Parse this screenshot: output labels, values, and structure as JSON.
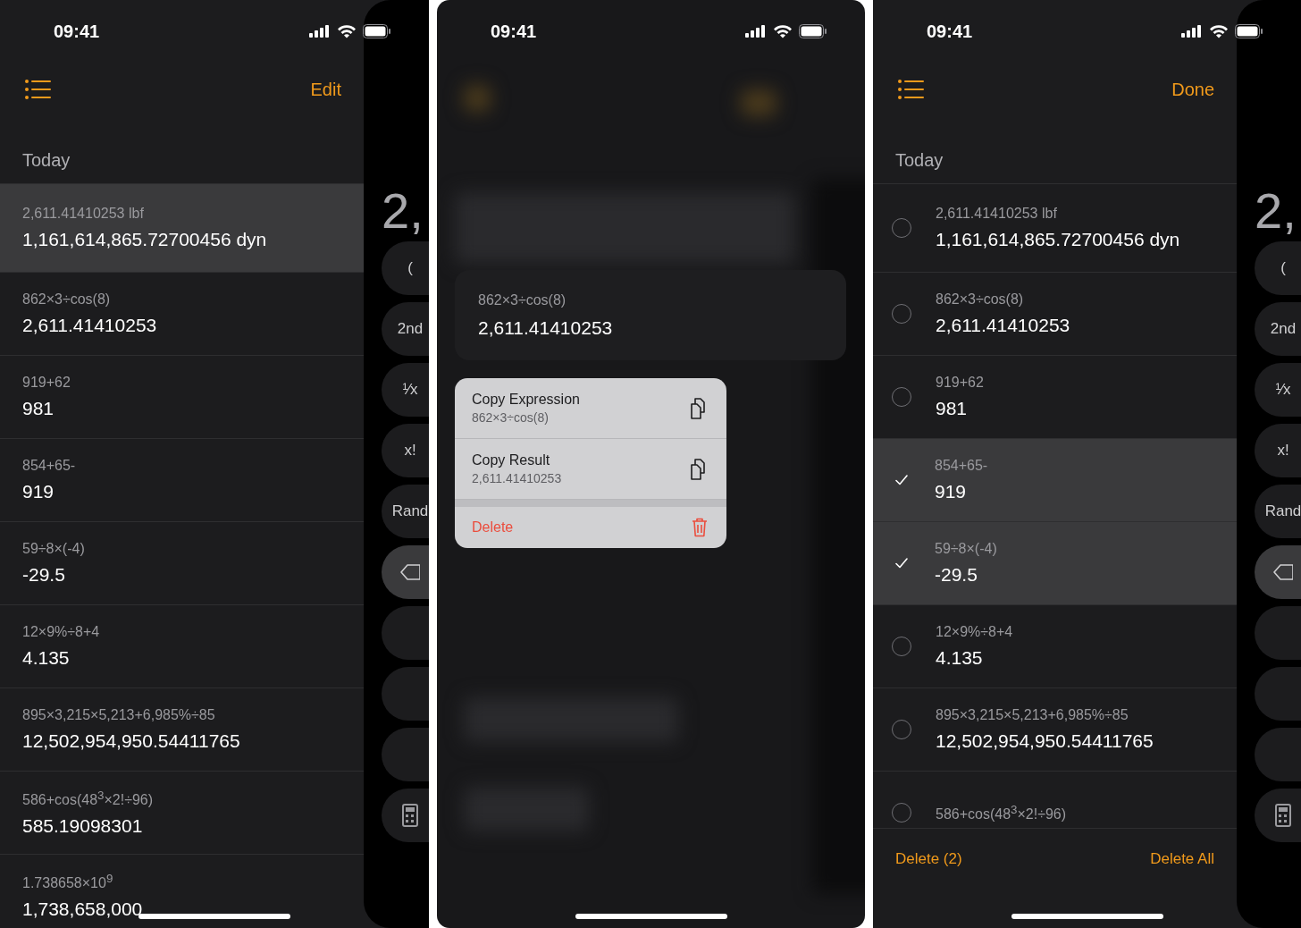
{
  "screens": [
    {
      "kind": "history",
      "time": "09:41",
      "nav_action": "Edit",
      "section": "Today",
      "items": [
        {
          "expression": "2,611.41410253 lbf",
          "result": "1,161,614,865.72700456 dyn",
          "selected": true
        },
        {
          "expression": "862×3÷cos(8)",
          "result": "2,611.41410253",
          "selected": false
        },
        {
          "expression": "919+62",
          "result": "981",
          "selected": false
        },
        {
          "expression": "854+65-",
          "result": "919",
          "selected": false
        },
        {
          "expression": "59÷8×(-4)",
          "result": "-29.5",
          "selected": false
        },
        {
          "expression": "12×9%÷8+4",
          "result": "4.135",
          "selected": false
        },
        {
          "expression": "895×3,215×5,213+6,985%÷85",
          "result": "12,502,954,950.54411765",
          "selected": false
        },
        {
          "expression": "586+cos(48$^{3}$×2!÷96)",
          "result": "585.19098301",
          "selected": false
        },
        {
          "expression": "1.738658×10$^{9}$",
          "result": "1,738,658,000",
          "selected": false
        }
      ],
      "peek": {
        "display": "2,",
        "keys": [
          {
            "kind": "text",
            "label": "("
          },
          {
            "kind": "text",
            "label": "2nd"
          },
          {
            "kind": "text",
            "label": "¹⁄x"
          },
          {
            "kind": "text",
            "label": "x!"
          },
          {
            "kind": "text",
            "label": "Rand"
          },
          {
            "kind": "backspace"
          },
          {
            "kind": "blank"
          },
          {
            "kind": "blank"
          },
          {
            "kind": "blank"
          },
          {
            "kind": "calculator"
          }
        ]
      }
    },
    {
      "kind": "menu",
      "time": "09:41",
      "preview": {
        "expression": "862×3÷cos(8)",
        "result": "2,611.41410253"
      },
      "actions": [
        {
          "kind": "copy",
          "title": "Copy Expression",
          "detail": "862×3÷cos(8)"
        },
        {
          "kind": "copy",
          "title": "Copy Result",
          "detail": "2,611.41410253"
        },
        {
          "kind": "delete",
          "title": "Delete"
        }
      ]
    },
    {
      "kind": "editing",
      "time": "09:41",
      "nav_action": "Done",
      "section": "Today",
      "items": [
        {
          "expression": "2,611.41410253 lbf",
          "result": "1,161,614,865.72700456 dyn",
          "checked": false
        },
        {
          "expression": "862×3÷cos(8)",
          "result": "2,611.41410253",
          "checked": false
        },
        {
          "expression": "919+62",
          "result": "981",
          "checked": false
        },
        {
          "expression": "854+65-",
          "result": "919",
          "checked": true
        },
        {
          "expression": "59÷8×(-4)",
          "result": "-29.5",
          "checked": true
        },
        {
          "expression": "12×9%÷8+4",
          "result": "4.135",
          "checked": false
        },
        {
          "expression": "895×3,215×5,213+6,985%÷85",
          "result": "12,502,954,950.54411765",
          "checked": false
        },
        {
          "expression": "586+cos(48$^{3}$×2!÷96)",
          "checked": false
        }
      ],
      "toolbar": [
        "Delete (2)",
        "Delete All"
      ],
      "peek": {
        "display": "2,",
        "keys": [
          {
            "kind": "text",
            "label": "("
          },
          {
            "kind": "text",
            "label": "2nd"
          },
          {
            "kind": "text",
            "label": "¹⁄x"
          },
          {
            "kind": "text",
            "label": "x!"
          },
          {
            "kind": "text",
            "label": "Rand"
          },
          {
            "kind": "backspace"
          },
          {
            "kind": "blank"
          },
          {
            "kind": "blank"
          },
          {
            "kind": "blank"
          },
          {
            "kind": "calculator"
          }
        ]
      }
    }
  ]
}
